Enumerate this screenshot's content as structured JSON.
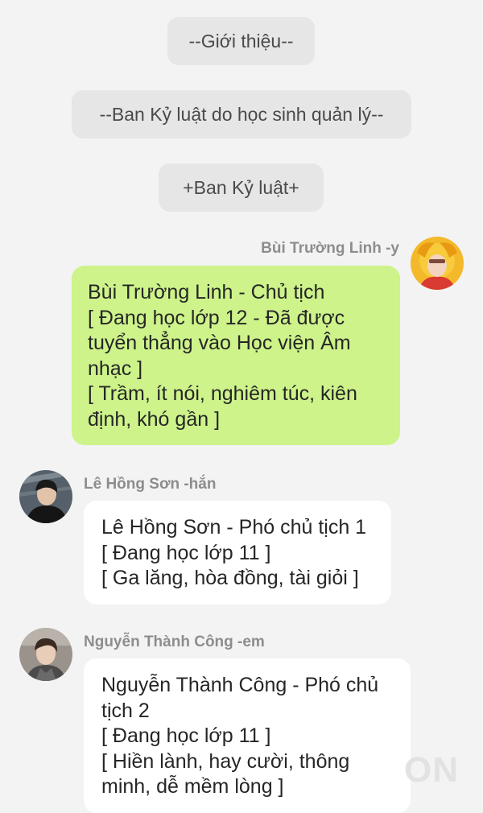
{
  "system_messages": [
    "--Giới thiệu--",
    "--Ban Kỷ luật do học sinh quản lý--",
    "+Ban Kỷ luật+"
  ],
  "messages": [
    {
      "sender": "Bùi Trường Linh -y",
      "side": "right",
      "bubble_color": "#cdf38a",
      "lines": [
        "Bùi Trường Linh - Chủ tịch",
        "[ Đang học lớp 12 - Đã được",
        "tuyển thẳng vào Học viện Âm",
        "nhạc ]",
        "[ Trầm, ít nói, nghiêm túc, kiên",
        "định, khó gần ]"
      ]
    },
    {
      "sender": "Lê Hồng Sơn -hắn",
      "side": "left",
      "bubble_color": "#ffffff",
      "lines": [
        "Lê Hồng Sơn - Phó chủ tịch 1",
        "[ Đang học lớp 11 ]",
        "[ Ga lăng, hòa đồng, tài giỏi ]"
      ]
    },
    {
      "sender": "Nguyễn Thành Công -em",
      "side": "left",
      "bubble_color": "#ffffff",
      "lines": [
        "Nguyễn Thành Công - Phó chủ",
        "tịch 2",
        "[ Đang học lớp 11 ]",
        "[ Hiền lành, hay cười, thông",
        "minh, dễ mềm lòng ]"
      ]
    }
  ],
  "watermark": "ON"
}
